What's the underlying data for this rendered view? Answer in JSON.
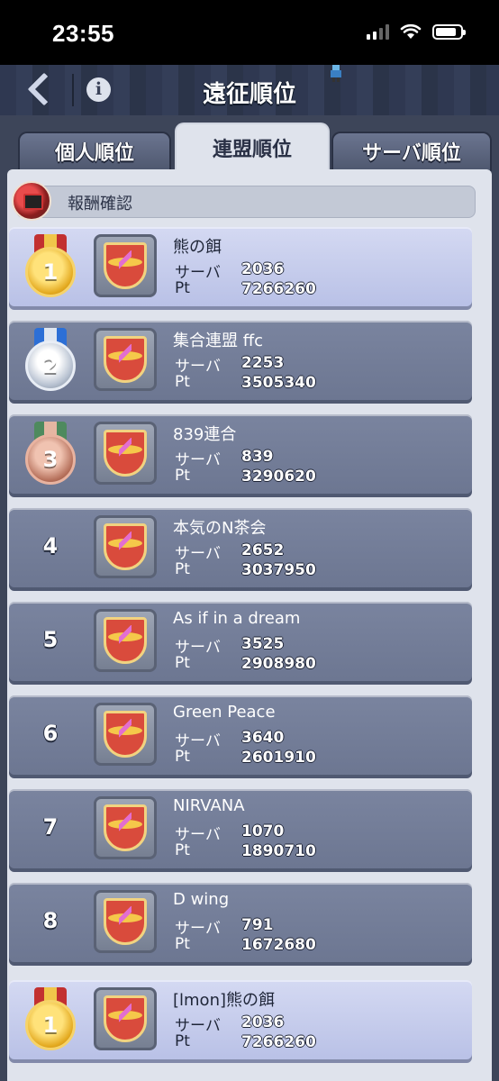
{
  "status_bar": {
    "time": "23:55"
  },
  "header": {
    "title": "遠征順位"
  },
  "tabs": [
    {
      "label": "個人順位",
      "active": false
    },
    {
      "label": "連盟順位",
      "active": true
    },
    {
      "label": "サーバ順位",
      "active": false
    }
  ],
  "reward": {
    "label": "報酬確認"
  },
  "labels": {
    "server": "サーバ",
    "points": "Pt"
  },
  "rankings": [
    {
      "rank": "1",
      "medal": "gold",
      "name": "熊の餌",
      "server": "2036",
      "pt": "7266260"
    },
    {
      "rank": "2",
      "medal": "silver",
      "name": "集合連盟 ffc",
      "server": "2253",
      "pt": "3505340"
    },
    {
      "rank": "3",
      "medal": "bronze",
      "name": "839連合",
      "server": "839",
      "pt": "3290620"
    },
    {
      "rank": "4",
      "medal": "none",
      "name": "本気のN茶会",
      "server": "2652",
      "pt": "3037950"
    },
    {
      "rank": "5",
      "medal": "none",
      "name": "As if in a dream",
      "server": "3525",
      "pt": "2908980"
    },
    {
      "rank": "6",
      "medal": "none",
      "name": "Green Peace",
      "server": "3640",
      "pt": "2601910"
    },
    {
      "rank": "7",
      "medal": "none",
      "name": "NIRVANA",
      "server": "1070",
      "pt": "1890710"
    },
    {
      "rank": "8",
      "medal": "none",
      "name": "D wing",
      "server": "791",
      "pt": "1672680"
    }
  ],
  "my_alliance": {
    "rank": "1",
    "medal": "gold",
    "name": "[lmon]熊の餌",
    "server": "2036",
    "pt": "7266260"
  },
  "colors": {
    "highlight_row": "#c4cbec",
    "normal_row": "#727c97",
    "panel": "#dfe3ec",
    "header": "#2f3851"
  }
}
